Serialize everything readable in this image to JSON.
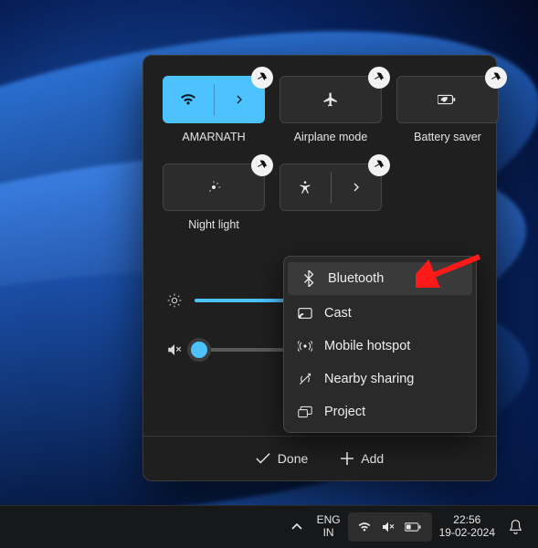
{
  "quick_settings": {
    "tiles": [
      {
        "label": "AMARNATH",
        "active": true,
        "icon": "wifi",
        "expandable": true,
        "unpin": true
      },
      {
        "label": "Airplane mode",
        "active": false,
        "icon": "airplane",
        "expandable": false,
        "unpin": true
      },
      {
        "label": "Battery saver",
        "active": false,
        "icon": "battery",
        "expandable": false,
        "unpin": true
      },
      {
        "label": "Night light",
        "active": false,
        "icon": "night",
        "expandable": false,
        "unpin": true
      },
      {
        "label": "",
        "active": false,
        "icon": "accessibility",
        "expandable": true,
        "unpin": true
      }
    ],
    "sliders": {
      "brightness": {
        "value": 42
      },
      "volume": {
        "value": 0,
        "muted": true
      }
    },
    "footer": {
      "done": "Done",
      "add": "Add"
    }
  },
  "add_menu": {
    "items": [
      {
        "icon": "bluetooth",
        "label": "Bluetooth",
        "highlight": true
      },
      {
        "icon": "cast",
        "label": "Cast"
      },
      {
        "icon": "hotspot",
        "label": "Mobile hotspot"
      },
      {
        "icon": "nearby",
        "label": "Nearby sharing"
      },
      {
        "icon": "project",
        "label": "Project"
      }
    ]
  },
  "taskbar": {
    "lang1": "ENG",
    "lang2": "IN",
    "time": "22:56",
    "date": "19-02-2024"
  }
}
